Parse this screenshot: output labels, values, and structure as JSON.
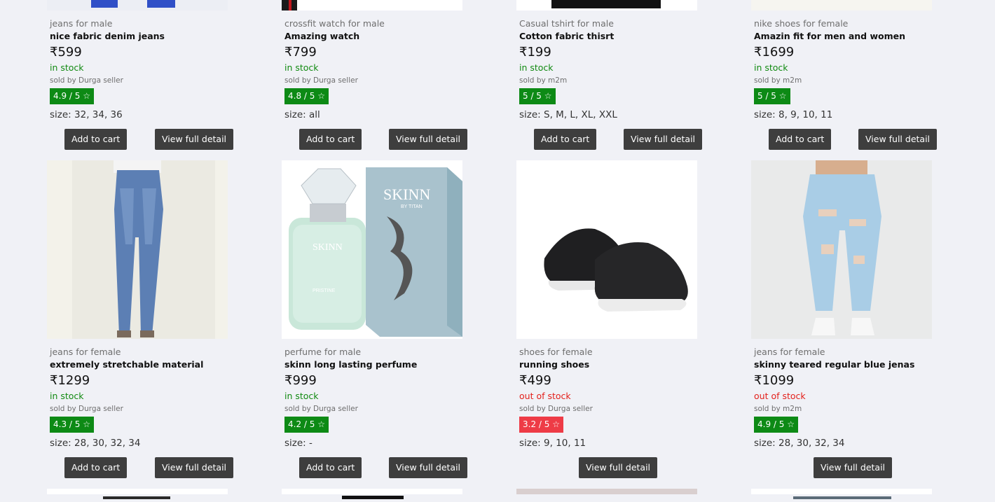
{
  "currency_symbol": "₹",
  "colors": {
    "in_stock": "#118a11",
    "out_of_stock": "#e3201b",
    "rating_good": "#0d8a15",
    "rating_low": "#ee3b46",
    "button_bg": "#3e3e3e"
  },
  "labels": {
    "add_to_cart": "Add to cart",
    "view_full_detail": "View full detail"
  },
  "products_row1": [
    {
      "category": "jeans for male",
      "name": "nice fabric denim jeans",
      "price": "₹599",
      "stock": "in stock",
      "seller": "sold by Durga seller",
      "rating": "4.9 / 5 ☆",
      "size": "size: 32, 34, 36",
      "image": "blue-jeans-bottom"
    },
    {
      "category": "crossfit watch for male",
      "name": "Amazing watch",
      "price": "₹799",
      "stock": "in stock",
      "seller": "sold by Durga seller",
      "rating": "4.8 / 5 ☆",
      "size": "size: all",
      "image": "watch-bottom"
    },
    {
      "category": "Casual tshirt for male",
      "name": "Cotton fabric thisrt",
      "price": "₹199",
      "stock": "in stock",
      "seller": "sold by m2m",
      "rating": "5 / 5 ☆",
      "size": "size: S, M, L, XL, XXL",
      "image": "black-tshirt-bottom"
    },
    {
      "category": "nike shoes for female",
      "name": "Amazin fit for men and women",
      "price": "₹1699",
      "stock": "in stock",
      "seller": "sold by m2m",
      "rating": "5 / 5 ☆",
      "size": "size: 8, 9, 10, 11",
      "image": "shoes-bottom"
    }
  ],
  "products_row2": [
    {
      "category": "jeans for female",
      "name": "extremely stretchable material",
      "price": "₹1299",
      "stock": "in stock",
      "seller": "sold by Durga seller",
      "rating": "4.3 / 5 ☆",
      "size": "size: 28, 30, 32, 34",
      "image": "blue-skinny-jeans"
    },
    {
      "category": "perfume for male",
      "name": "skinn long lasting perfume",
      "price": "₹999",
      "stock": "in stock",
      "seller": "sold by Durga seller",
      "rating": "4.2 / 5 ☆",
      "size": "size: -",
      "image": "skinn-perfume",
      "brand": "SKINN",
      "brand_sub": "BY TITAN",
      "variant": "PRISTINE"
    },
    {
      "category": "shoes for female",
      "name": "running shoes",
      "price": "₹499",
      "stock": "out of stock",
      "seller": "sold by Durga seller",
      "rating": "3.2 / 5 ☆",
      "size": "size: 9, 10, 11",
      "image": "black-running-shoes"
    },
    {
      "category": "jeans for female",
      "name": "skinny teared regular blue jenas",
      "price": "₹1099",
      "stock": "out of stock",
      "seller": "sold by m2m",
      "rating": "4.9 / 5 ☆",
      "size": "size: 28, 30, 32, 34",
      "image": "ripped-light-jeans"
    }
  ]
}
